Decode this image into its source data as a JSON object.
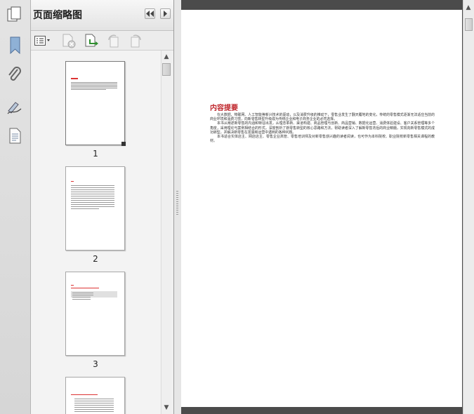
{
  "pane": {
    "title": "页面缩略图"
  },
  "thumbnails": [
    {
      "number": "1"
    },
    {
      "number": "2"
    },
    {
      "number": "3"
    }
  ],
  "document": {
    "heading": "内容提要",
    "paragraphs": [
      "在大数据、物联网、人工智能等新兴技术的驱动，以及消费升级的推动下，零售业发生了翻天覆地的变化，传统的零售模式逐渐无法适应当前的商业环境和消费习惯，向新零售转型升级成为传统企业和电子商务企业的必然选择。",
      "本书从阐述新零售的内涵和特征出发，从理念革新、渠道构建、商品管理与创新、商品营销、数据化运营、消费体验建设、客户关系管理等多个角度，采用理论与案例相结合的形式，深度剖析了新零售转型的核心思路和方法，帮助读者深入了解新零售背后的商业精髓，实现向新零售模式的成功转型，并解决新零售在发展和运营中遇到的各种问题。",
      "本书适合实体店主、网店店主、零售企业高管、零售培训师及对新零售感兴趣的读者阅读，也可作为本科院校、职业院校新零售相关课程的教材。"
    ]
  },
  "colors": {
    "heading_red": "#c0272d",
    "document_background": "#4b4b4b"
  },
  "icons": {
    "sidebar": [
      "pages-icon",
      "bookmark-icon",
      "attachment-icon",
      "signature-icon",
      "document-icon"
    ],
    "toolbar": [
      "options-menu-icon",
      "delete-page-icon",
      "insert-page-icon",
      "rotate-left-icon",
      "rotate-right-icon"
    ]
  }
}
